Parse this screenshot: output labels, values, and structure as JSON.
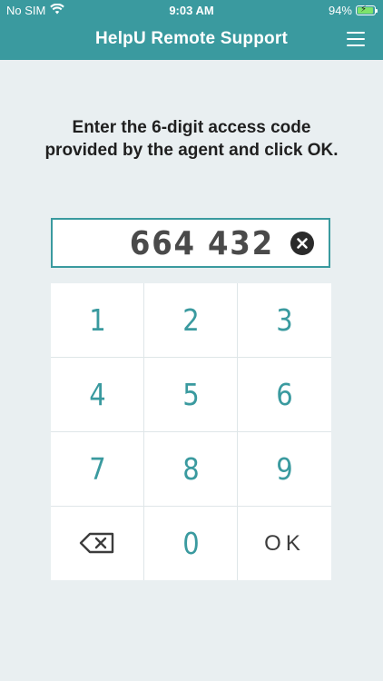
{
  "status_bar": {
    "carrier": "No SIM",
    "time": "9:03 AM",
    "battery_percent": "94%",
    "battery_level": 0.94,
    "icons": [
      "wifi-icon",
      "battery-charging-icon"
    ]
  },
  "header": {
    "title": "HelpU Remote Support",
    "menu_icon": "hamburger-menu-icon",
    "bg_color": "#3a9a9f"
  },
  "instructions": "Enter the 6-digit access code provided by the agent and click OK.",
  "code_input": {
    "value": "664 432",
    "clear_icon": "clear-circle-x-icon"
  },
  "keypad": {
    "keys": [
      "1",
      "2",
      "3",
      "4",
      "5",
      "6",
      "7",
      "8",
      "9"
    ],
    "backspace_icon": "backspace-icon",
    "zero": "0",
    "ok": "OK"
  },
  "colors": {
    "accent": "#3a9a9f",
    "background": "#e9eff1"
  }
}
